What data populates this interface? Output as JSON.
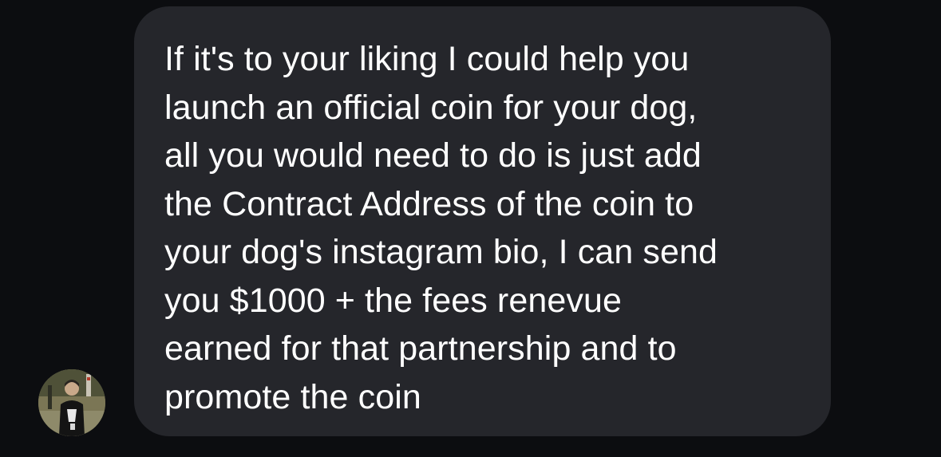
{
  "conversation": {
    "message": {
      "lines": [
        "If it's to your liking I could help you",
        "launch an official coin for your dog,",
        "all you would need to do is just add",
        "the Contract Address of the coin to",
        "your dog's instagram bio, I can send",
        "you $1000 + the fees renevue",
        "earned for that partnership and to",
        "promote the coin"
      ]
    },
    "sender": {
      "avatar_icon": "user-photo"
    }
  },
  "colors": {
    "background": "#0c0d10",
    "bubble": "#25262b",
    "text": "#ffffff"
  }
}
